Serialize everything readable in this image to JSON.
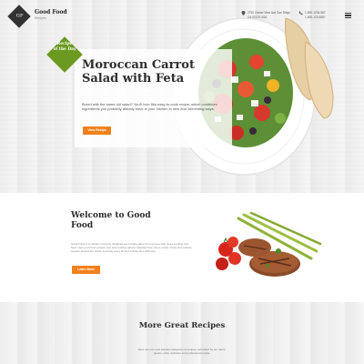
{
  "header": {
    "logo_text": "GF",
    "brand_name": "Good Food",
    "brand_tag": "Recipes",
    "address_line1": "2730 Ocean View Ave San Diego",
    "address_line2": "CA 92110 USA",
    "phone_line1": "1-800-1234-567",
    "phone_line2": "1-800-123-4567"
  },
  "hero": {
    "badge_line1": "Recipe",
    "badge_line2": "of the Day",
    "title": "Moroccan Carrot Salad with Feta",
    "text": "Bored with the same old salad? You'll love this easy-to-cook recipe, which combines ingredients you probably already have in your kitchen in new and interesting ways.",
    "button_label": "View Recipe"
  },
  "welcome": {
    "title": "Welcome to Good Food",
    "text": "Good Food is a culinary resource designed as a single place for everyone who loves cooking and food. Here you'll find recipes, tips and cooking advice collected from home cooks, chefs and culinary experts around the world, covering every kind of cuisine and skill level.",
    "button_label": "Learn More"
  },
  "more": {
    "title": "More Great Recipes",
    "text": "Here are our most popular categories of recipes, submitted by our users, guests, other websites and professional cooks."
  },
  "colors": {
    "accent": "#f2801b",
    "badge": "#6a9a1f",
    "dark": "#333333"
  }
}
